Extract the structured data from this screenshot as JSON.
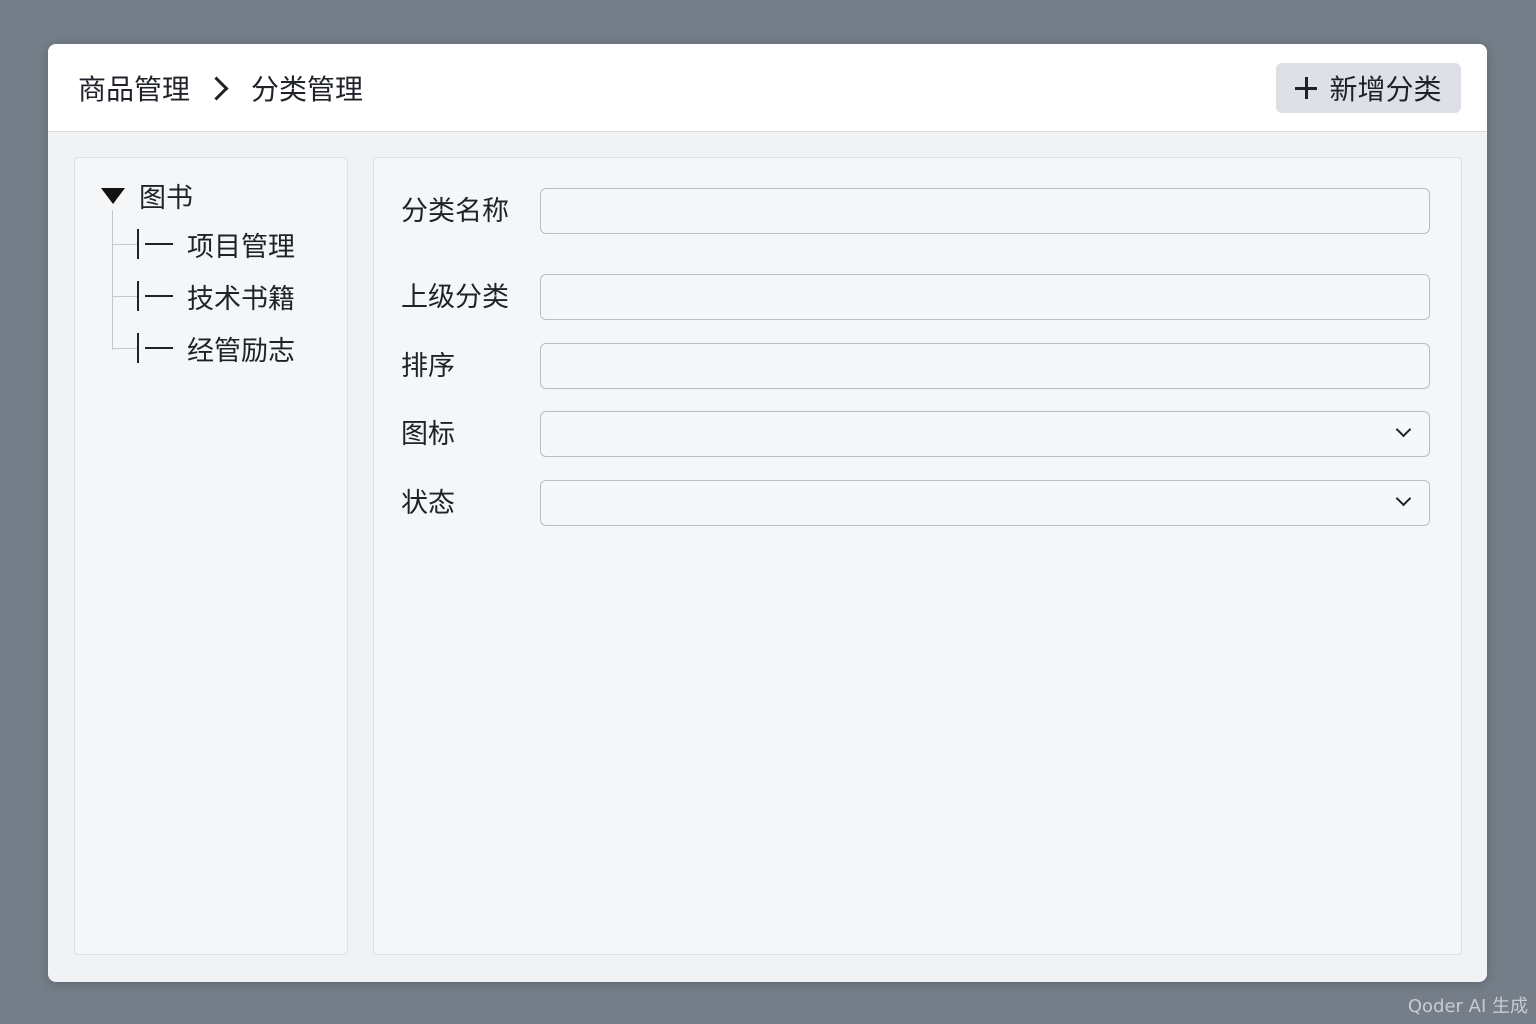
{
  "header": {
    "breadcrumb": [
      "商品管理",
      "分类管理"
    ],
    "add_button_label": "新增分类"
  },
  "tree": {
    "root_label": "图书",
    "children": [
      "项目管理",
      "技术书籍",
      "经管励志"
    ]
  },
  "form": {
    "name_label": "分类名称",
    "name_value": "",
    "parent_label": "上级分类",
    "parent_value": "",
    "sort_label": "排序",
    "sort_value": "",
    "icon_label": "图标",
    "icon_value": "",
    "status_label": "状态",
    "status_value": ""
  },
  "watermark": "Qoder AI 生成"
}
